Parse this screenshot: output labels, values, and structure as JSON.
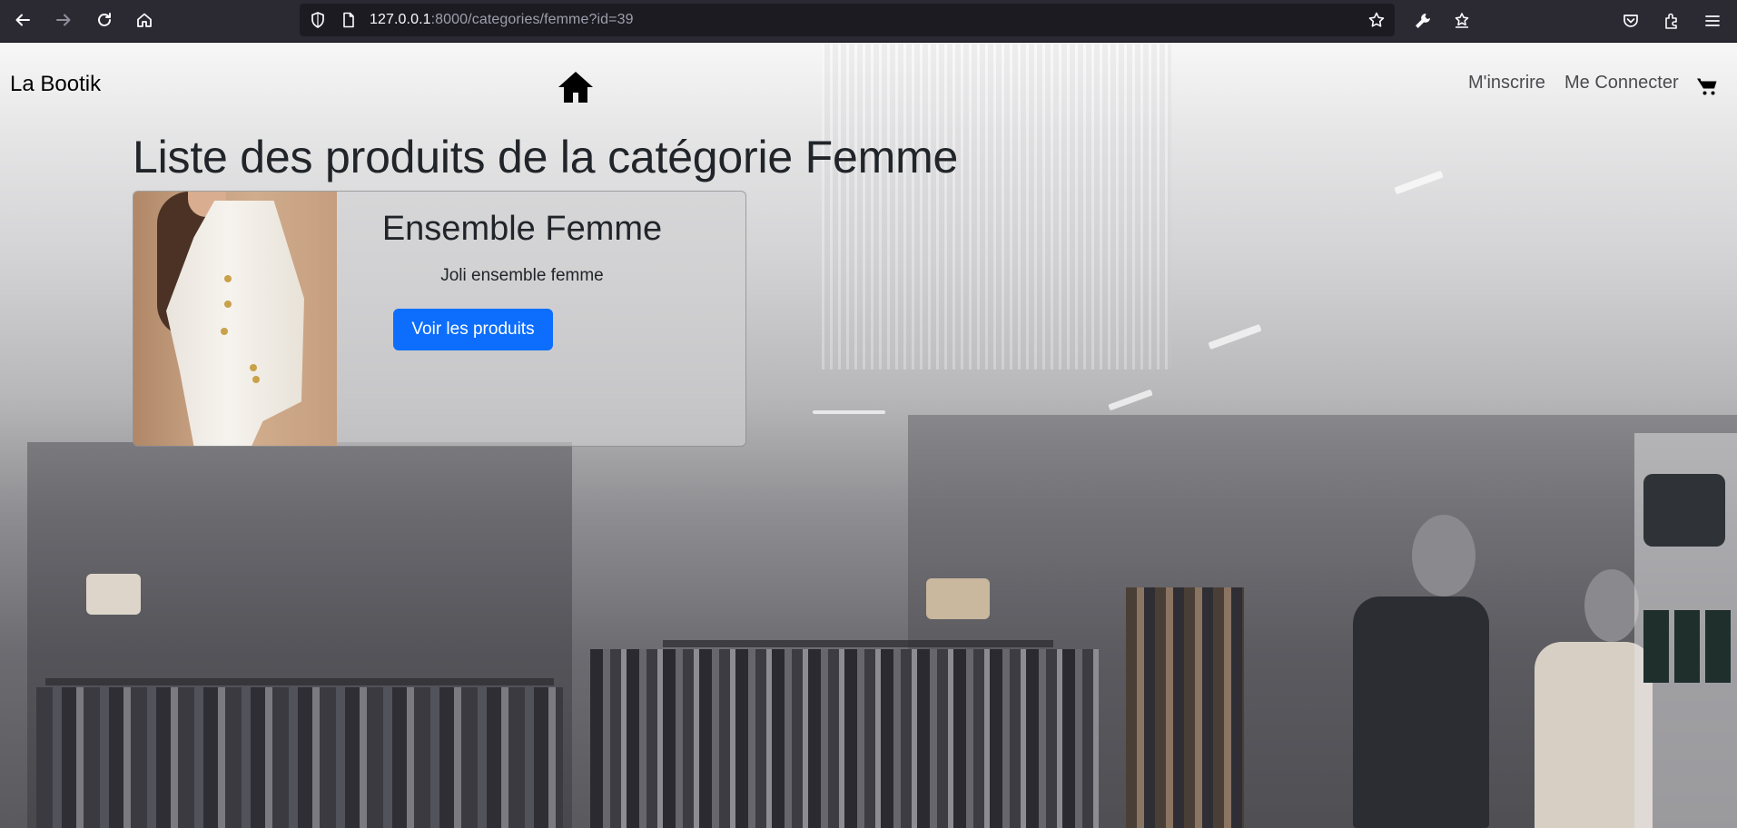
{
  "browser": {
    "url_host": "127.0.0.1",
    "url_rest": ":8000/categories/femme?id=39",
    "icons": [
      "back-icon",
      "forward-icon",
      "reload-icon",
      "home-icon",
      "shield-icon",
      "page-icon",
      "star-icon",
      "wrench-icon",
      "save-icon",
      "pocket-icon",
      "extensions-icon",
      "menu-icon"
    ]
  },
  "navbar": {
    "brand": "La Bootik",
    "links": [
      {
        "label": "M'inscrire"
      },
      {
        "label": "Me Connecter"
      }
    ]
  },
  "main": {
    "title": "Liste des produits de la catégorie Femme",
    "products": [
      {
        "name": "Ensemble Femme",
        "description": "Joli ensemble femme",
        "button_label": "Voir les produits"
      }
    ]
  },
  "colors": {
    "primary_button": "#0d6efd",
    "chrome_bg": "#2b2a33",
    "urlbar_bg": "#1c1b22"
  }
}
